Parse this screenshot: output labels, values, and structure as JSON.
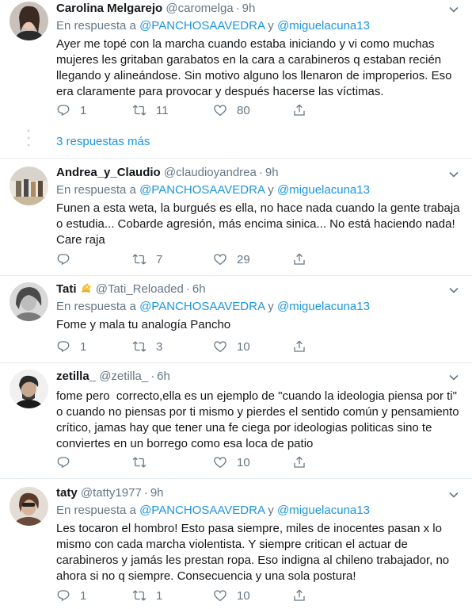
{
  "reply_label": "En respuesta a",
  "reply_conjunction": "y",
  "more_replies": "3 respuestas más",
  "tweets": [
    {
      "name": "Carolina Melgarejo",
      "handle": "@caromelga",
      "time": "9h",
      "mention1": "@PANCHOSAAVEDRA",
      "mention2": "@miguelacuna13",
      "text": "Ayer me topé con la marcha cuando estaba iniciando y vi como muchas mujeres les gritaban garabatos en la cara a carabineros q estaban recién llegando y alineándose. Sin motivo alguno los llenaron de improperios. Eso era claramente para provocar y después hacerse las víctimas.",
      "replies": "1",
      "retweets": "11",
      "likes": "80"
    },
    {
      "name": "Andrea_y_Claudio",
      "handle": "@claudioyandrea",
      "time": "9h",
      "mention1": "@PANCHOSAAVEDRA",
      "mention2": "@miguelacuna13",
      "text": "Funen a esta weta, la burgués es ella, no hace nada cuando la gente trabaja o estudia... Cobarde agresión, más encima sinica... No está haciendo nada! Care raja",
      "replies": "",
      "retweets": "7",
      "likes": "29"
    },
    {
      "name": "Tati",
      "handle": "@Tati_Reloaded",
      "time": "6h",
      "mention1": "@PANCHOSAAVEDRA",
      "mention2": "@miguelacuna13",
      "text": "Fome y mala tu analogía Pancho",
      "replies": "1",
      "retweets": "3",
      "likes": "10"
    },
    {
      "name": "zetilla_",
      "handle": "@zetilla_",
      "time": "6h",
      "text": "fome pero  correcto,ella es un ejemplo de \"cuando la ideologia piensa por ti\" o cuando no piensas por ti mismo y pierdes el sentido común y pensamiento crítico, jamas hay que tener una fe ciega por ideologias politicas sino te conviertes en un borrego como esa loca de patio",
      "replies": "",
      "retweets": "",
      "likes": "10"
    },
    {
      "name": "taty",
      "handle": "@tatty1977",
      "time": "9h",
      "mention1": "@PANCHOSAAVEDRA",
      "mention2": "@miguelacuna13",
      "text": "Les tocaron el hombro! Esto pasa siempre, miles de inocentes pasan x lo mismo con cada marcha violentista. Y siempre critican el actuar de carabineros y jamás les prestan ropa. Eso indigna al chileno trabajador, no ahora si no q siempre. Consecuencia y una sola postura!",
      "replies": "1",
      "retweets": "1",
      "likes": "10"
    }
  ],
  "colors": {
    "link": "#1b95e0",
    "secondary": "#657786",
    "border": "#e6ecf0"
  }
}
